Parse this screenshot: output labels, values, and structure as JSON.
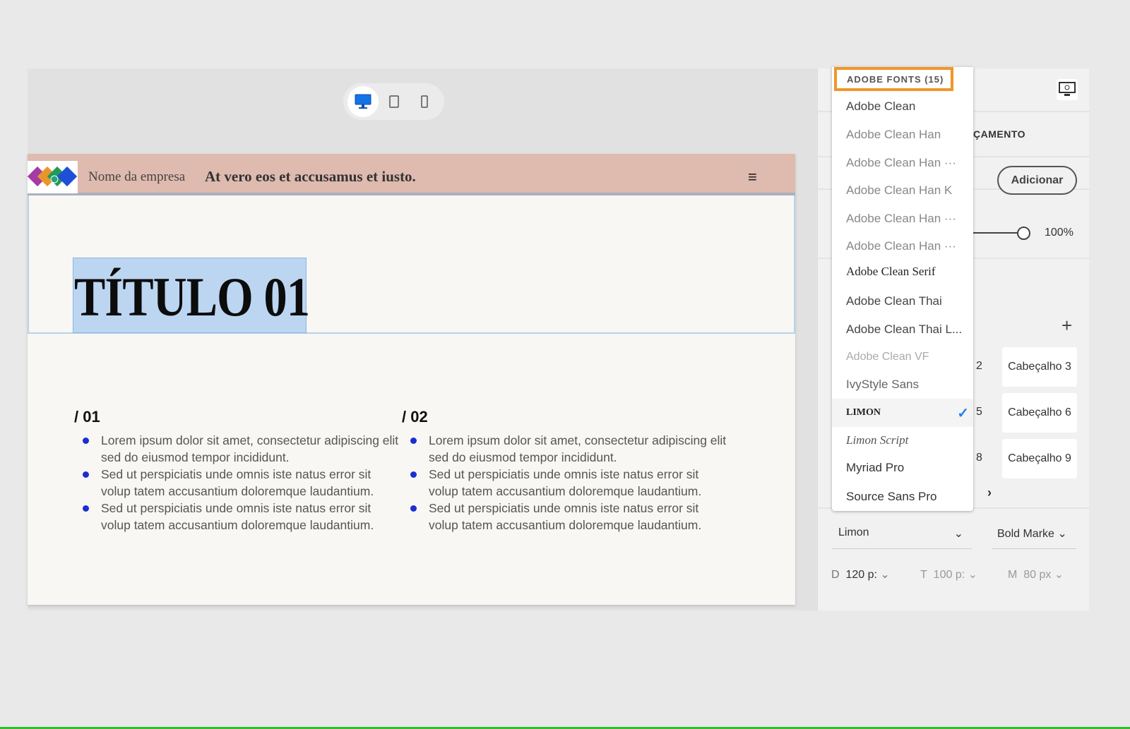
{
  "canvas": {
    "devices": [
      {
        "name": "desktop",
        "active": true
      },
      {
        "name": "tablet",
        "active": false
      },
      {
        "name": "mobile",
        "active": false
      }
    ],
    "header": {
      "company": "Nome da empresa",
      "tagline": "At vero eos et accusamus et iusto.",
      "menu_icon": "≡"
    },
    "title": "TÍTULO 01",
    "columns": [
      {
        "heading": "/ 01",
        "bullets": [
          "Lorem ipsum dolor sit amet, consectetur adipiscing elit sed do eiusmod tempor incididunt.",
          "Sed ut perspiciatis unde omnis iste natus error sit volup tatem accusantium doloremque laudantium.",
          "Sed ut perspiciatis unde omnis iste natus error sit volup tatem accusantium doloremque laudantium."
        ]
      },
      {
        "heading": "/ 02",
        "bullets": [
          "Lorem ipsum dolor sit amet, consectetur adipiscing elit sed do eiusmod tempor incididunt.",
          "Sed ut perspiciatis unde omnis iste natus error sit volup tatem accusantium doloremque laudantium.",
          "Sed ut perspiciatis unde omnis iste natus error sit volup tatem accusantium doloremque laudantium."
        ]
      }
    ]
  },
  "panel": {
    "tab_heading": "ÇAMENTO",
    "add_label": "Adicionar",
    "opacity": "100%",
    "opacity_value": 100,
    "cards": [
      "2",
      "Cabeçalho 3",
      "5",
      "Cabeçalho 6",
      "8",
      "Cabeçalho 9"
    ],
    "next": "›",
    "font_family": "Limon",
    "font_weight": "Bold Marke",
    "sizes": [
      {
        "label": "D",
        "value": "120 p:"
      },
      {
        "label": "T",
        "value": "100 p:"
      },
      {
        "label": "M",
        "value": "80 px"
      }
    ]
  },
  "dropdown": {
    "header": "ADOBE FONTS (15)",
    "items": [
      "Adobe Clean",
      "Adobe Clean Han",
      "Adobe Clean Han ···",
      "Adobe Clean Han K",
      "Adobe Clean Han ···",
      "Adobe Clean Han ···",
      "Adobe Clean Serif",
      "Adobe Clean Thai",
      "Adobe Clean Thai L...",
      "Adobe Clean VF",
      "IvyStyle Sans",
      "LIMON",
      "Limon Script",
      "Myriad Pro",
      "Source Sans Pro"
    ],
    "selected": "LIMON",
    "check_color": "#2680eb",
    "highlight_color": "#f0962a"
  }
}
